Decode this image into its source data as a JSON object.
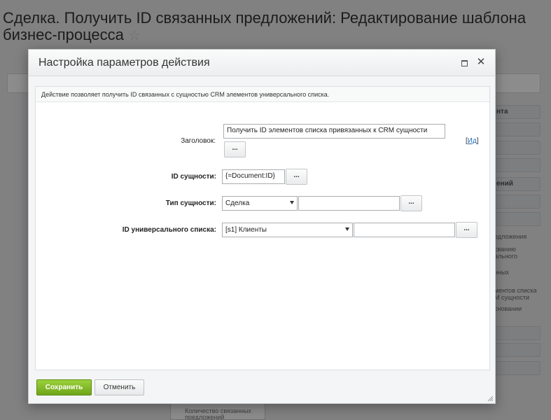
{
  "page": {
    "title": "Сделка. Получить ID связанных предложений: Редактирование шаблона бизнес-процесса",
    "star": "☆",
    "right_items": [
      "нта",
      "ений"
    ],
    "right_texts": [
      "едложения",
      "сванию ального",
      "нных",
      "ментов списка М сущности",
      "сновании"
    ],
    "bottom_box": "Количество связанных предложений"
  },
  "dialog": {
    "title": "Настройка параметров действия",
    "description": "Действие позволяет получить ID связанных с сущностью CRM элементов универсального списка.",
    "fields": {
      "header_label": "Заголовок:",
      "header_value": "Получить ID элементов списка привязанных к CRM сущности",
      "header_link_open": "[",
      "header_link": "Ид",
      "header_link_close": "]",
      "entity_id_label": "ID сущности:",
      "entity_id_value": "{=Document:ID}",
      "entity_type_label": "Тип сущности:",
      "entity_type_value": "Сделка",
      "list_id_label": "ID универсального списка:",
      "list_id_value": "[s1] Клиенты"
    },
    "dots_label": "...",
    "save_label": "Сохранить",
    "cancel_label": "Отменить"
  }
}
